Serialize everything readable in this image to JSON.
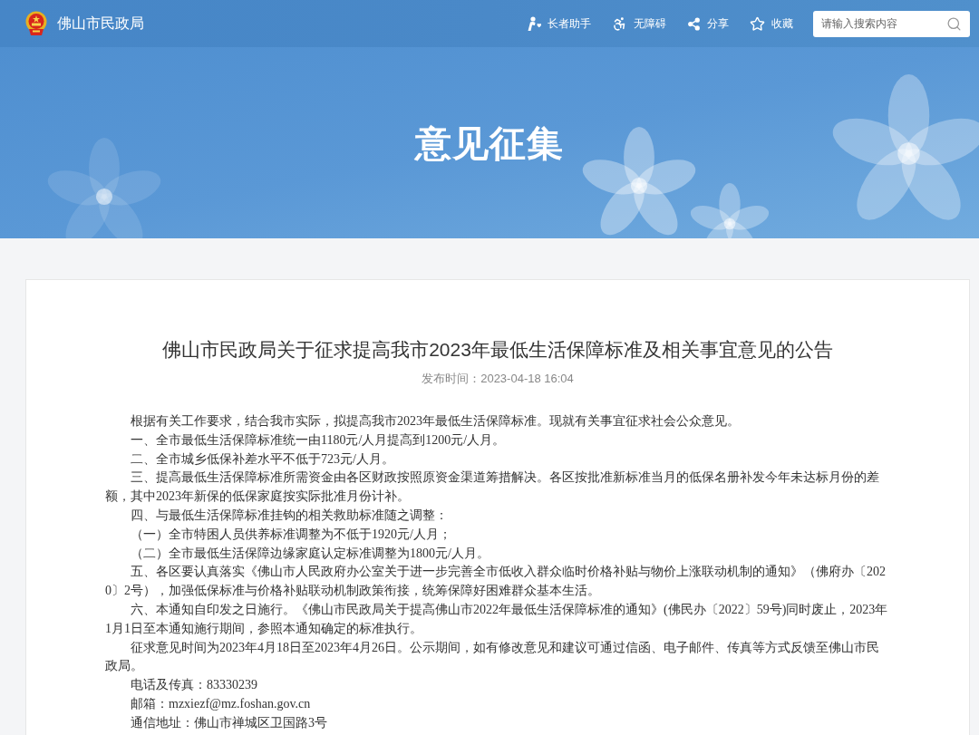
{
  "header": {
    "site_name": "佛山市民政局",
    "tools": [
      {
        "label": "长者助手"
      },
      {
        "label": "无障碍"
      },
      {
        "label": "分享"
      },
      {
        "label": "收藏"
      }
    ],
    "search": {
      "placeholder": "请输入搜索内容"
    }
  },
  "banner": {
    "title": "意见征集"
  },
  "article": {
    "title": "佛山市民政局关于征求提高我市2023年最低生活保障标准及相关事宜意见的公告",
    "published": "发布时间：2023-04-18 16:04",
    "paragraphs": [
      "根据有关工作要求，结合我市实际，拟提高我市2023年最低生活保障标准。现就有关事宜征求社会公众意见。",
      "一、全市最低生活保障标准统一由1180元/人月提高到1200元/人月。",
      "二、全市城乡低保补差水平不低于723元/人月。",
      "三、提高最低生活保障标准所需资金由各区财政按照原资金渠道筹措解决。各区按批准新标准当月的低保名册补发今年未达标月份的差额，其中2023年新保的低保家庭按实际批准月份计补。",
      "四、与最低生活保障标准挂钩的相关救助标准随之调整：",
      "（一）全市特困人员供养标准调整为不低于1920元/人月；",
      "（二）全市最低生活保障边缘家庭认定标准调整为1800元/人月。",
      "五、各区要认真落实《佛山市人民政府办公室关于进一步完善全市低收入群众临时价格补贴与物价上涨联动机制的通知》（佛府办〔2020〕2号），加强低保标准与价格补贴联动机制政策衔接，统筹保障好困难群众基本生活。",
      "六、本通知自印发之日施行。《佛山市民政局关于提高佛山市2022年最低生活保障标准的通知》(佛民办〔2022〕59号)同时废止，2023年1月1日至本通知施行期间，参照本通知确定的标准执行。",
      "征求意见时间为2023年4月18日至2023年4月26日。公示期间，如有修改意见和建议可通过信函、电子邮件、传真等方式反馈至佛山市民政局。",
      "电话及传真：83330239",
      "邮箱：mzxiezf@mz.foshan.gov.cn",
      "通信地址：佛山市禅城区卫国路3号"
    ]
  }
}
